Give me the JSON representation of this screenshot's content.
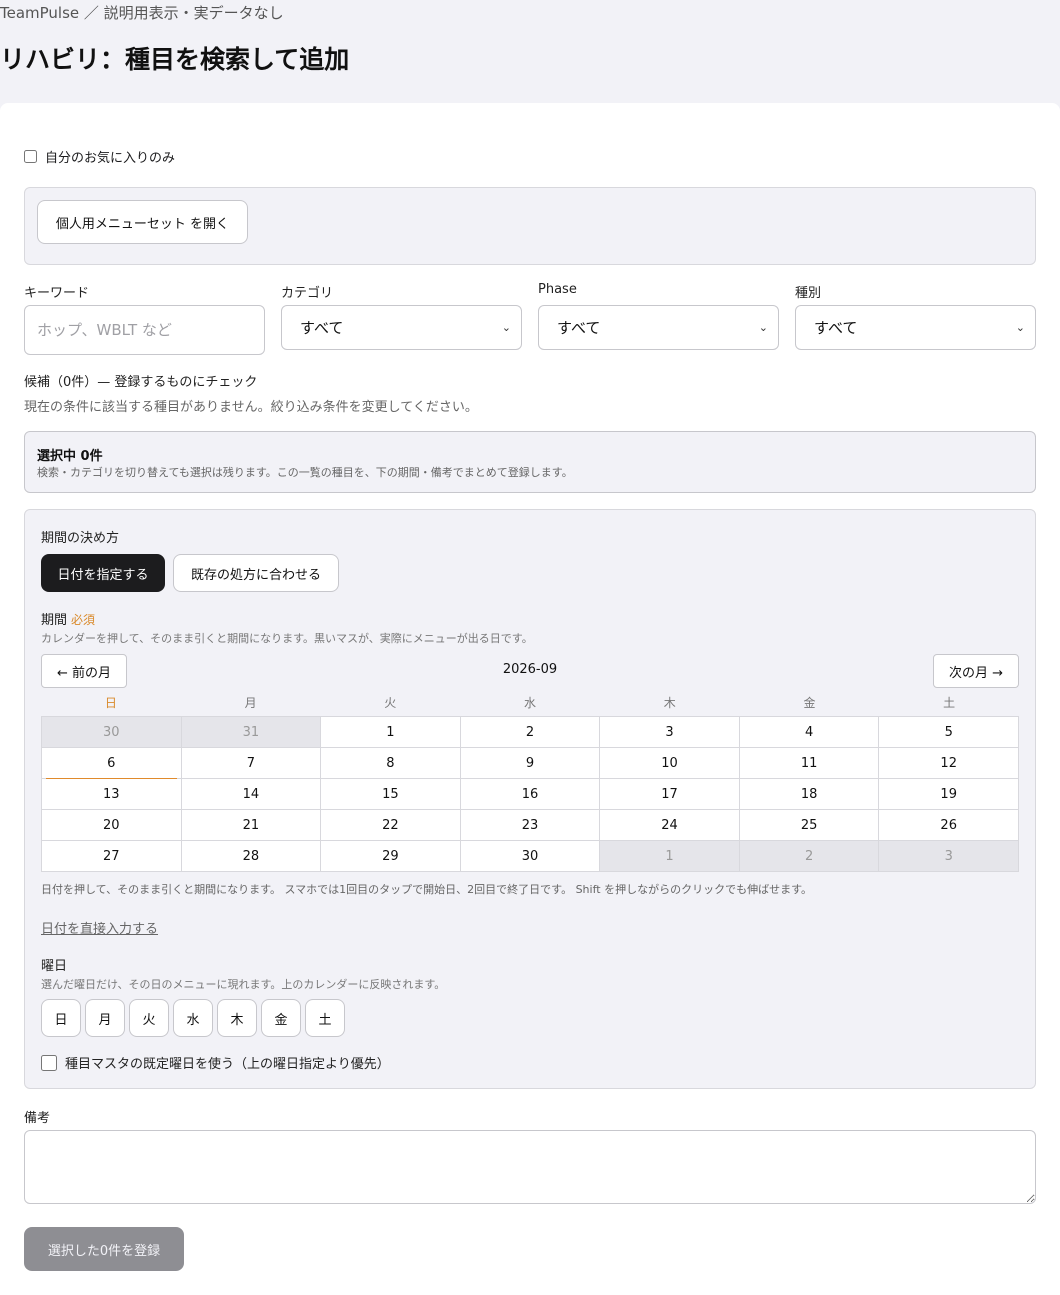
{
  "breadcrumb": "TeamPulse ／ 説明用表示・実データなし",
  "page_title": "リハビリ：種目を検索して追加",
  "favorites_only_label": "自分のお気に入りのみ",
  "menuset_button": "個人用メニューセット を開く",
  "filters": {
    "keyword_label": "キーワード",
    "keyword_placeholder": "ホップ、WBLT など",
    "category_label": "カテゴリ",
    "category_value": "すべて",
    "phase_label": "Phase",
    "phase_value": "すべて",
    "type_label": "種別",
    "type_value": "すべて"
  },
  "candidates": {
    "title": "候補（0件）— 登録するものにチェック",
    "empty_message": "現在の条件に該当する種目がありません。絞り込み条件を変更してください。"
  },
  "selected": {
    "count_label": "選択中 0件",
    "note": "検索・カテゴリを切り替えても選択は残ります。この一覧の種目を、下の期間・備考でまとめて登録します。"
  },
  "period": {
    "method_label": "期間の決め方",
    "specify_dates_button": "日付を指定する",
    "match_existing_button": "既存の処方に合わせる",
    "period_label": "期間",
    "required_label": "必須",
    "period_hint": "カレンダーを押して、そのまま引くと期間になります。黒いマスが、実際にメニューが出る日です。",
    "prev_month": "← 前の月",
    "next_month": "次の月 →",
    "month": "2026-09",
    "weekday_headers": [
      "日",
      "月",
      "火",
      "水",
      "木",
      "金",
      "土"
    ],
    "calendar_hint": "日付を押して、そのまま引くと期間になります。 スマホでは1回目のタップで開始日、2回目で終了日です。 Shift を押しながらのクリックでも伸ばせます。",
    "direct_input_link": "日付を直接入力する",
    "weekday_label": "曜日",
    "weekday_hint": "選んだ曜日だけ、その日のメニューに現れます。上のカレンダーに反映されます。",
    "weekday_buttons": [
      "日",
      "月",
      "火",
      "水",
      "木",
      "金",
      "土"
    ],
    "master_default_label": "種目マスタの既定曜日を使う（上の曜日指定より優先）"
  },
  "calendar_days": [
    {
      "d": "30",
      "out": true
    },
    {
      "d": "31",
      "out": true
    },
    {
      "d": "1"
    },
    {
      "d": "2"
    },
    {
      "d": "3"
    },
    {
      "d": "4"
    },
    {
      "d": "5"
    },
    {
      "d": "6",
      "today": true
    },
    {
      "d": "7"
    },
    {
      "d": "8"
    },
    {
      "d": "9"
    },
    {
      "d": "10"
    },
    {
      "d": "11"
    },
    {
      "d": "12"
    },
    {
      "d": "13"
    },
    {
      "d": "14"
    },
    {
      "d": "15"
    },
    {
      "d": "16"
    },
    {
      "d": "17"
    },
    {
      "d": "18"
    },
    {
      "d": "19"
    },
    {
      "d": "20"
    },
    {
      "d": "21"
    },
    {
      "d": "22"
    },
    {
      "d": "23"
    },
    {
      "d": "24"
    },
    {
      "d": "25"
    },
    {
      "d": "26"
    },
    {
      "d": "27"
    },
    {
      "d": "28"
    },
    {
      "d": "29"
    },
    {
      "d": "30"
    },
    {
      "d": "1",
      "out": true
    },
    {
      "d": "2",
      "out": true
    },
    {
      "d": "3",
      "out": true
    }
  ],
  "notes_label": "備考",
  "submit_button": "選択した0件を登録",
  "colors": {
    "accent_orange": "#d98a2b",
    "dark_button": "#1c1c1e",
    "disabled_button": "#8e8e93"
  }
}
